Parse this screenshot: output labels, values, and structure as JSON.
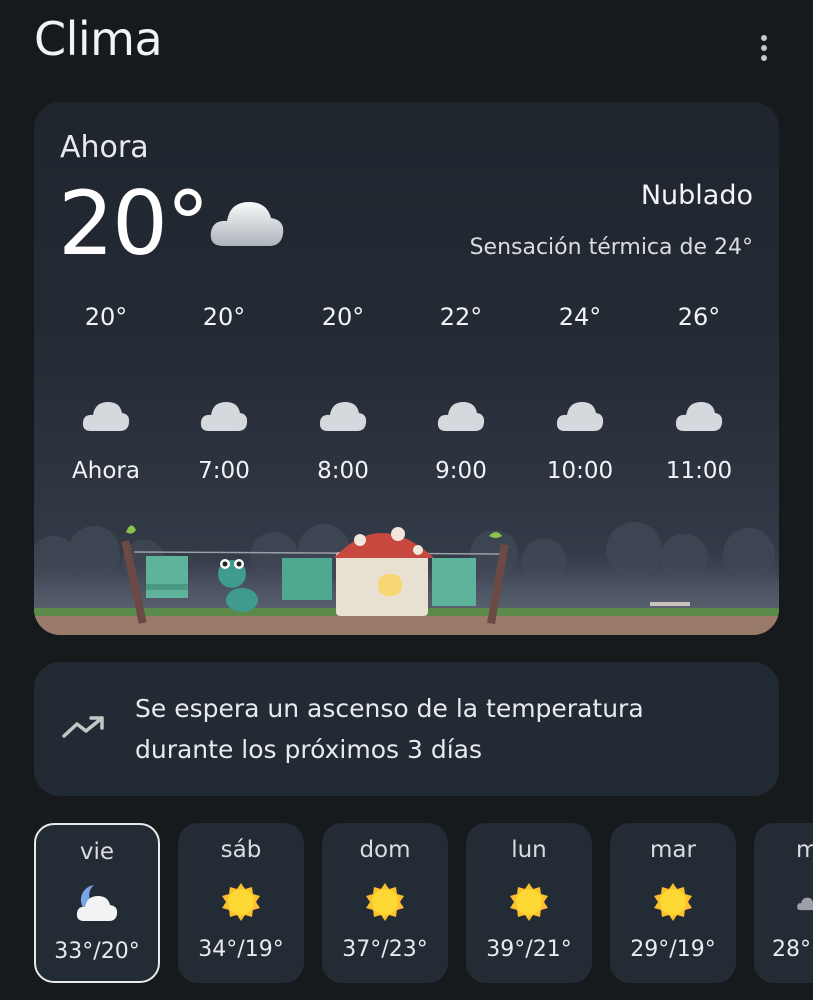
{
  "app": {
    "title": "Clima"
  },
  "current": {
    "label": "Ahora",
    "temp": "20°",
    "condition": "Nublado",
    "feels_like": "Sensación térmica de 24°",
    "icon": "cloud-icon"
  },
  "hourly": [
    {
      "temp": "20°",
      "time": "Ahora",
      "icon": "cloud-icon"
    },
    {
      "temp": "20°",
      "time": "7:00",
      "icon": "cloud-icon"
    },
    {
      "temp": "20°",
      "time": "8:00",
      "icon": "cloud-icon"
    },
    {
      "temp": "22°",
      "time": "9:00",
      "icon": "cloud-icon"
    },
    {
      "temp": "24°",
      "time": "10:00",
      "icon": "cloud-icon"
    },
    {
      "temp": "26°",
      "time": "11:00",
      "icon": "cloud-icon"
    }
  ],
  "insight": {
    "icon": "trending-up-icon",
    "text": "Se espera un ascenso de la temperatura durante los próximos 3 días"
  },
  "daily": [
    {
      "day": "vie",
      "range": "33°/20°",
      "icon": "moon-cloud-icon",
      "selected": true
    },
    {
      "day": "sáb",
      "range": "34°/19°",
      "icon": "sun-icon"
    },
    {
      "day": "dom",
      "range": "37°/23°",
      "icon": "sun-icon"
    },
    {
      "day": "lun",
      "range": "39°/21°",
      "icon": "sun-icon"
    },
    {
      "day": "mar",
      "range": "29°/19°",
      "icon": "sun-icon"
    },
    {
      "day": "m",
      "range": "28°",
      "icon": "cloud-icon"
    }
  ],
  "colors": {
    "background": "#161a1d",
    "card": "#232b34",
    "sun": "#fbc02d"
  }
}
